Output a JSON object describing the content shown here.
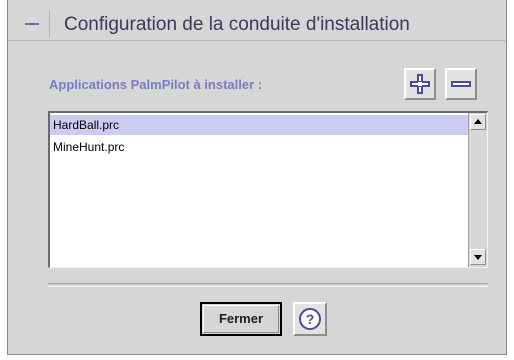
{
  "window": {
    "title": "Configuration de la conduite d'installation"
  },
  "main": {
    "applications_label": "Applications PalmPilot à installer :",
    "files": [
      "HardBall.prc",
      "MineHunt.prc"
    ],
    "selected_index": 0
  },
  "buttons": {
    "add_icon": "plus-icon",
    "remove_icon": "minus-icon",
    "close_label": "Fermer",
    "help_icon": "help-icon",
    "help_glyph": "?"
  },
  "colors": {
    "accent": "#7b7bc8",
    "selection": "#ccccf2",
    "background": "#d6d6d6"
  }
}
